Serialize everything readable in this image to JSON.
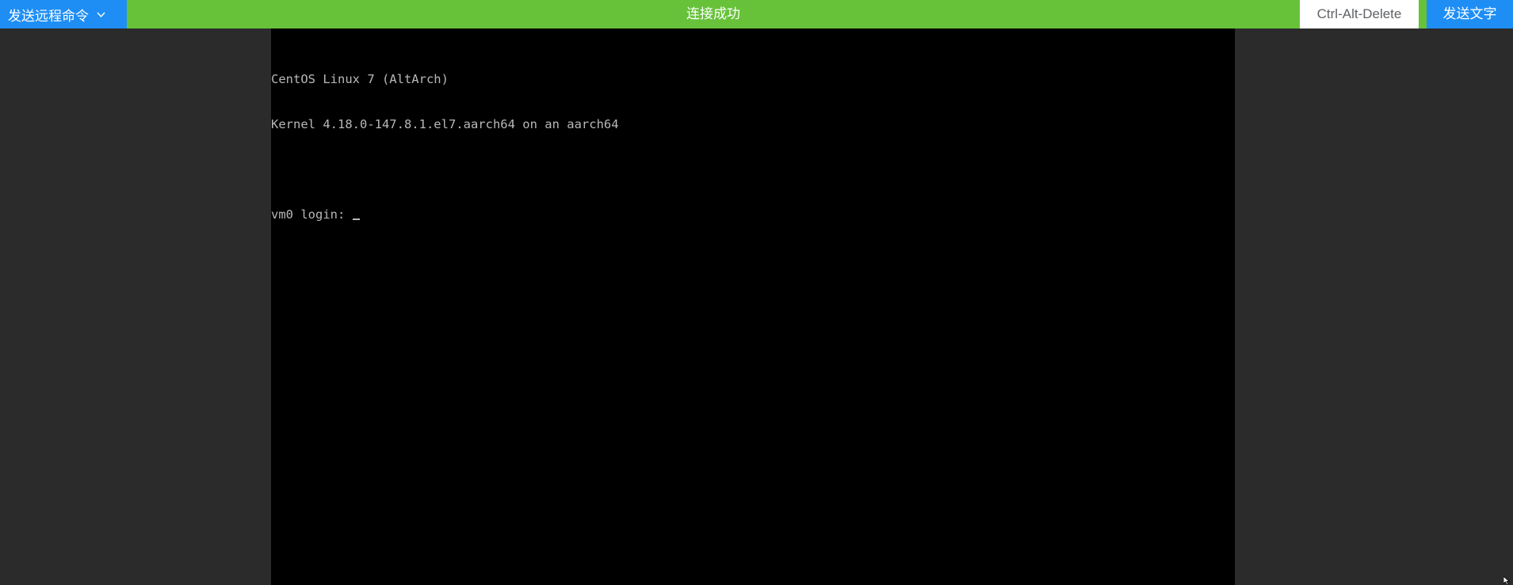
{
  "toolbar": {
    "dropdown_label": "发送远程命令",
    "dropdown_icon": "chevron-down-icon",
    "status_text": "连接成功",
    "ctrl_alt_delete_label": "Ctrl-Alt-Delete",
    "send_text_label": "发送文字"
  },
  "console": {
    "lines": [
      "CentOS Linux 7 (AltArch)",
      "Kernel 4.18.0-147.8.1.el7.aarch64 on an aarch64",
      "",
      "vm0 login: "
    ]
  },
  "colors": {
    "toolbar_green": "#67c23a",
    "button_blue": "#1e8ef5",
    "background": "#2b2b2b",
    "console_bg": "#000000",
    "console_text": "#b8b8b8"
  }
}
